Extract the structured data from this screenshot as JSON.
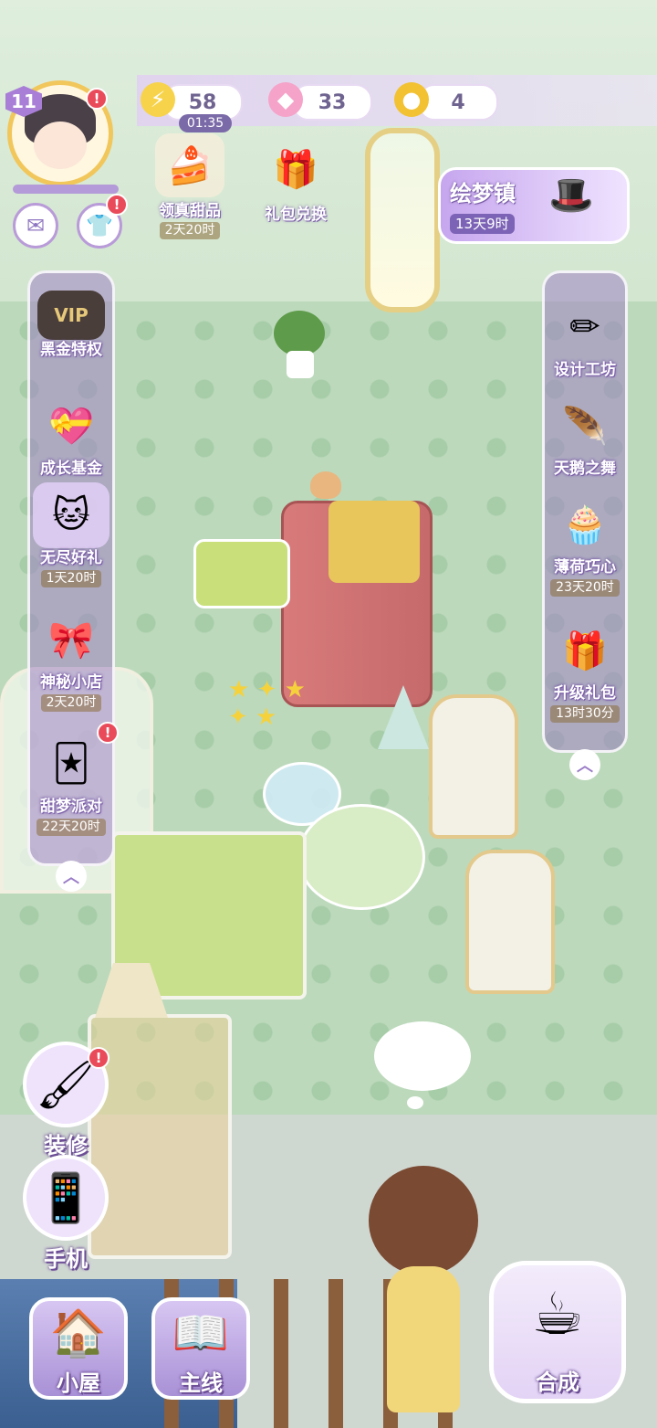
{
  "player": {
    "level": "11"
  },
  "resources": {
    "energy": "58",
    "energy_timer": "01:35",
    "gems": "33",
    "coins": "4"
  },
  "top_events": [
    {
      "label": "领真甜品",
      "timer": "2天20时",
      "icon": "cake-icon"
    },
    {
      "label": "礼包兑换",
      "icon": "gift-icon"
    }
  ],
  "dream_town": {
    "title": "绘梦镇",
    "timer": "13天9时"
  },
  "left_panel": [
    {
      "label": "黑金特权",
      "badge_text": "VIP"
    },
    {
      "label": "成长基金"
    },
    {
      "label": "无尽好礼",
      "timer": "1天20时"
    },
    {
      "label": "神秘小店",
      "timer": "2天20时"
    },
    {
      "label": "甜梦派对",
      "timer": "22天20时"
    }
  ],
  "right_panel": [
    {
      "label": "设计工坊"
    },
    {
      "label": "天鹅之舞"
    },
    {
      "label": "薄荷巧心",
      "timer": "23天20时"
    },
    {
      "label": "升级礼包",
      "timer": "13时30分"
    }
  ],
  "side_actions": {
    "decorate": "装修",
    "phone": "手机"
  },
  "bottom_nav": {
    "house": "小屋",
    "main_quest": "主线",
    "merge": "合成"
  },
  "colors": {
    "accent_purple": "#a884d6",
    "alert_red": "#e94b5a",
    "gold": "#f1c65b"
  }
}
